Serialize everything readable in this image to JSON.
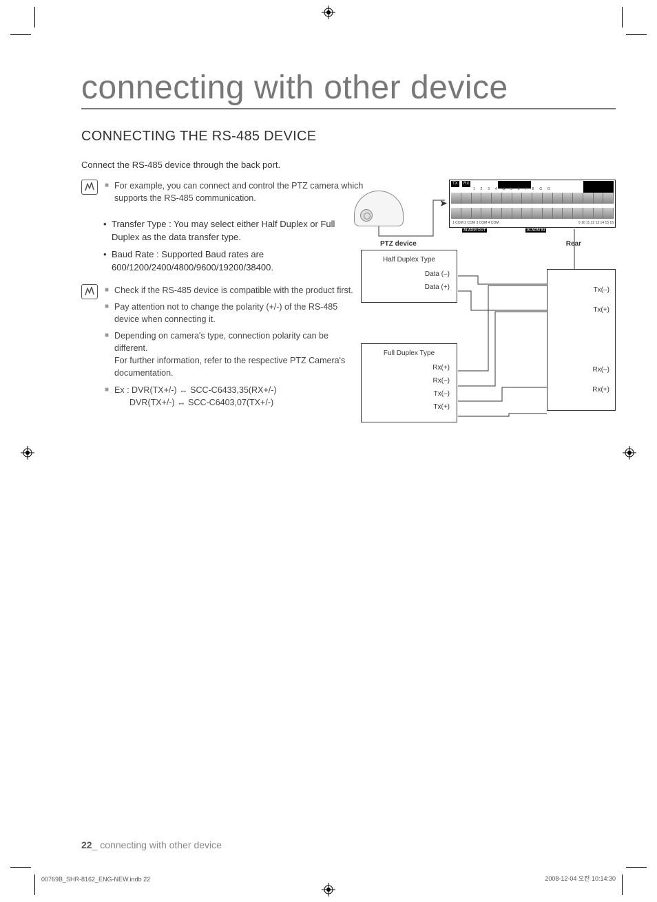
{
  "title": "connecting with other device",
  "section_title": "CONNECTING THE RS-485 DEVICE",
  "intro": "Connect the RS-485 device through the back port.",
  "note1": {
    "item1": "For example, you can connect and control the PTZ camera which supports the RS-485 communication."
  },
  "bullets": {
    "b1": "Transfer Type : You may select either Half Duplex or Full Duplex as the data transfer type.",
    "b2": "Baud Rate : Supported Baud rates are 600/1200/2400/4800/9600/19200/38400."
  },
  "note2": {
    "i1": "Check if the RS-485 device is compatible with the product first.",
    "i2": "Pay attention not to change the polarity (+/-) of the RS-485 device when connecting it.",
    "i3a": "Depending on camera's type, connection polarity can be different.",
    "i3b": "For further information, refer to the respective PTZ Camera's documentation.",
    "i4a": "Ex : DVR(TX+/-) ↔ SCC-C6433,35(RX+/-)",
    "i4b": "DVR(TX+/-) ↔ SCC-C6403,07(TX+/-)"
  },
  "diagram": {
    "ptz_label": "PTZ device",
    "rear_label": "Rear",
    "half": {
      "title": "Half Duplex Type",
      "r1": "Data (–)",
      "r2": "Data (+)"
    },
    "full": {
      "title": "Full Duplex Type",
      "r1": "Rx(+)",
      "r2": "Rx(–)",
      "r3": "Tx(–)",
      "r4": "Tx(+)"
    },
    "rear": {
      "r1": "Tx(–)",
      "r2": "Tx(+)",
      "r3": "Rx(–)",
      "r4": "Rx(+)"
    },
    "term": {
      "tx": "TX",
      "rx": "RX",
      "alarm_in": "ALARM IN",
      "alarm_reset": "ALARM RESET",
      "top_nums": "1 2 3 4 G 5 6 7 8 G   G",
      "alarm_out": "ALARM OUT",
      "alarm_in2": "ALARM IN",
      "bot_left": "1 COM 2 COM 3 COM 4 COM",
      "bot_right": "9 10 11 12 13 14 15 16"
    }
  },
  "footer": {
    "page": "22",
    "label": "_ connecting with other device"
  },
  "print": {
    "left": "00769B_SHR-8162_ENG-NEW.indb   22",
    "right": "2008-12-04   오전 10:14:30"
  }
}
